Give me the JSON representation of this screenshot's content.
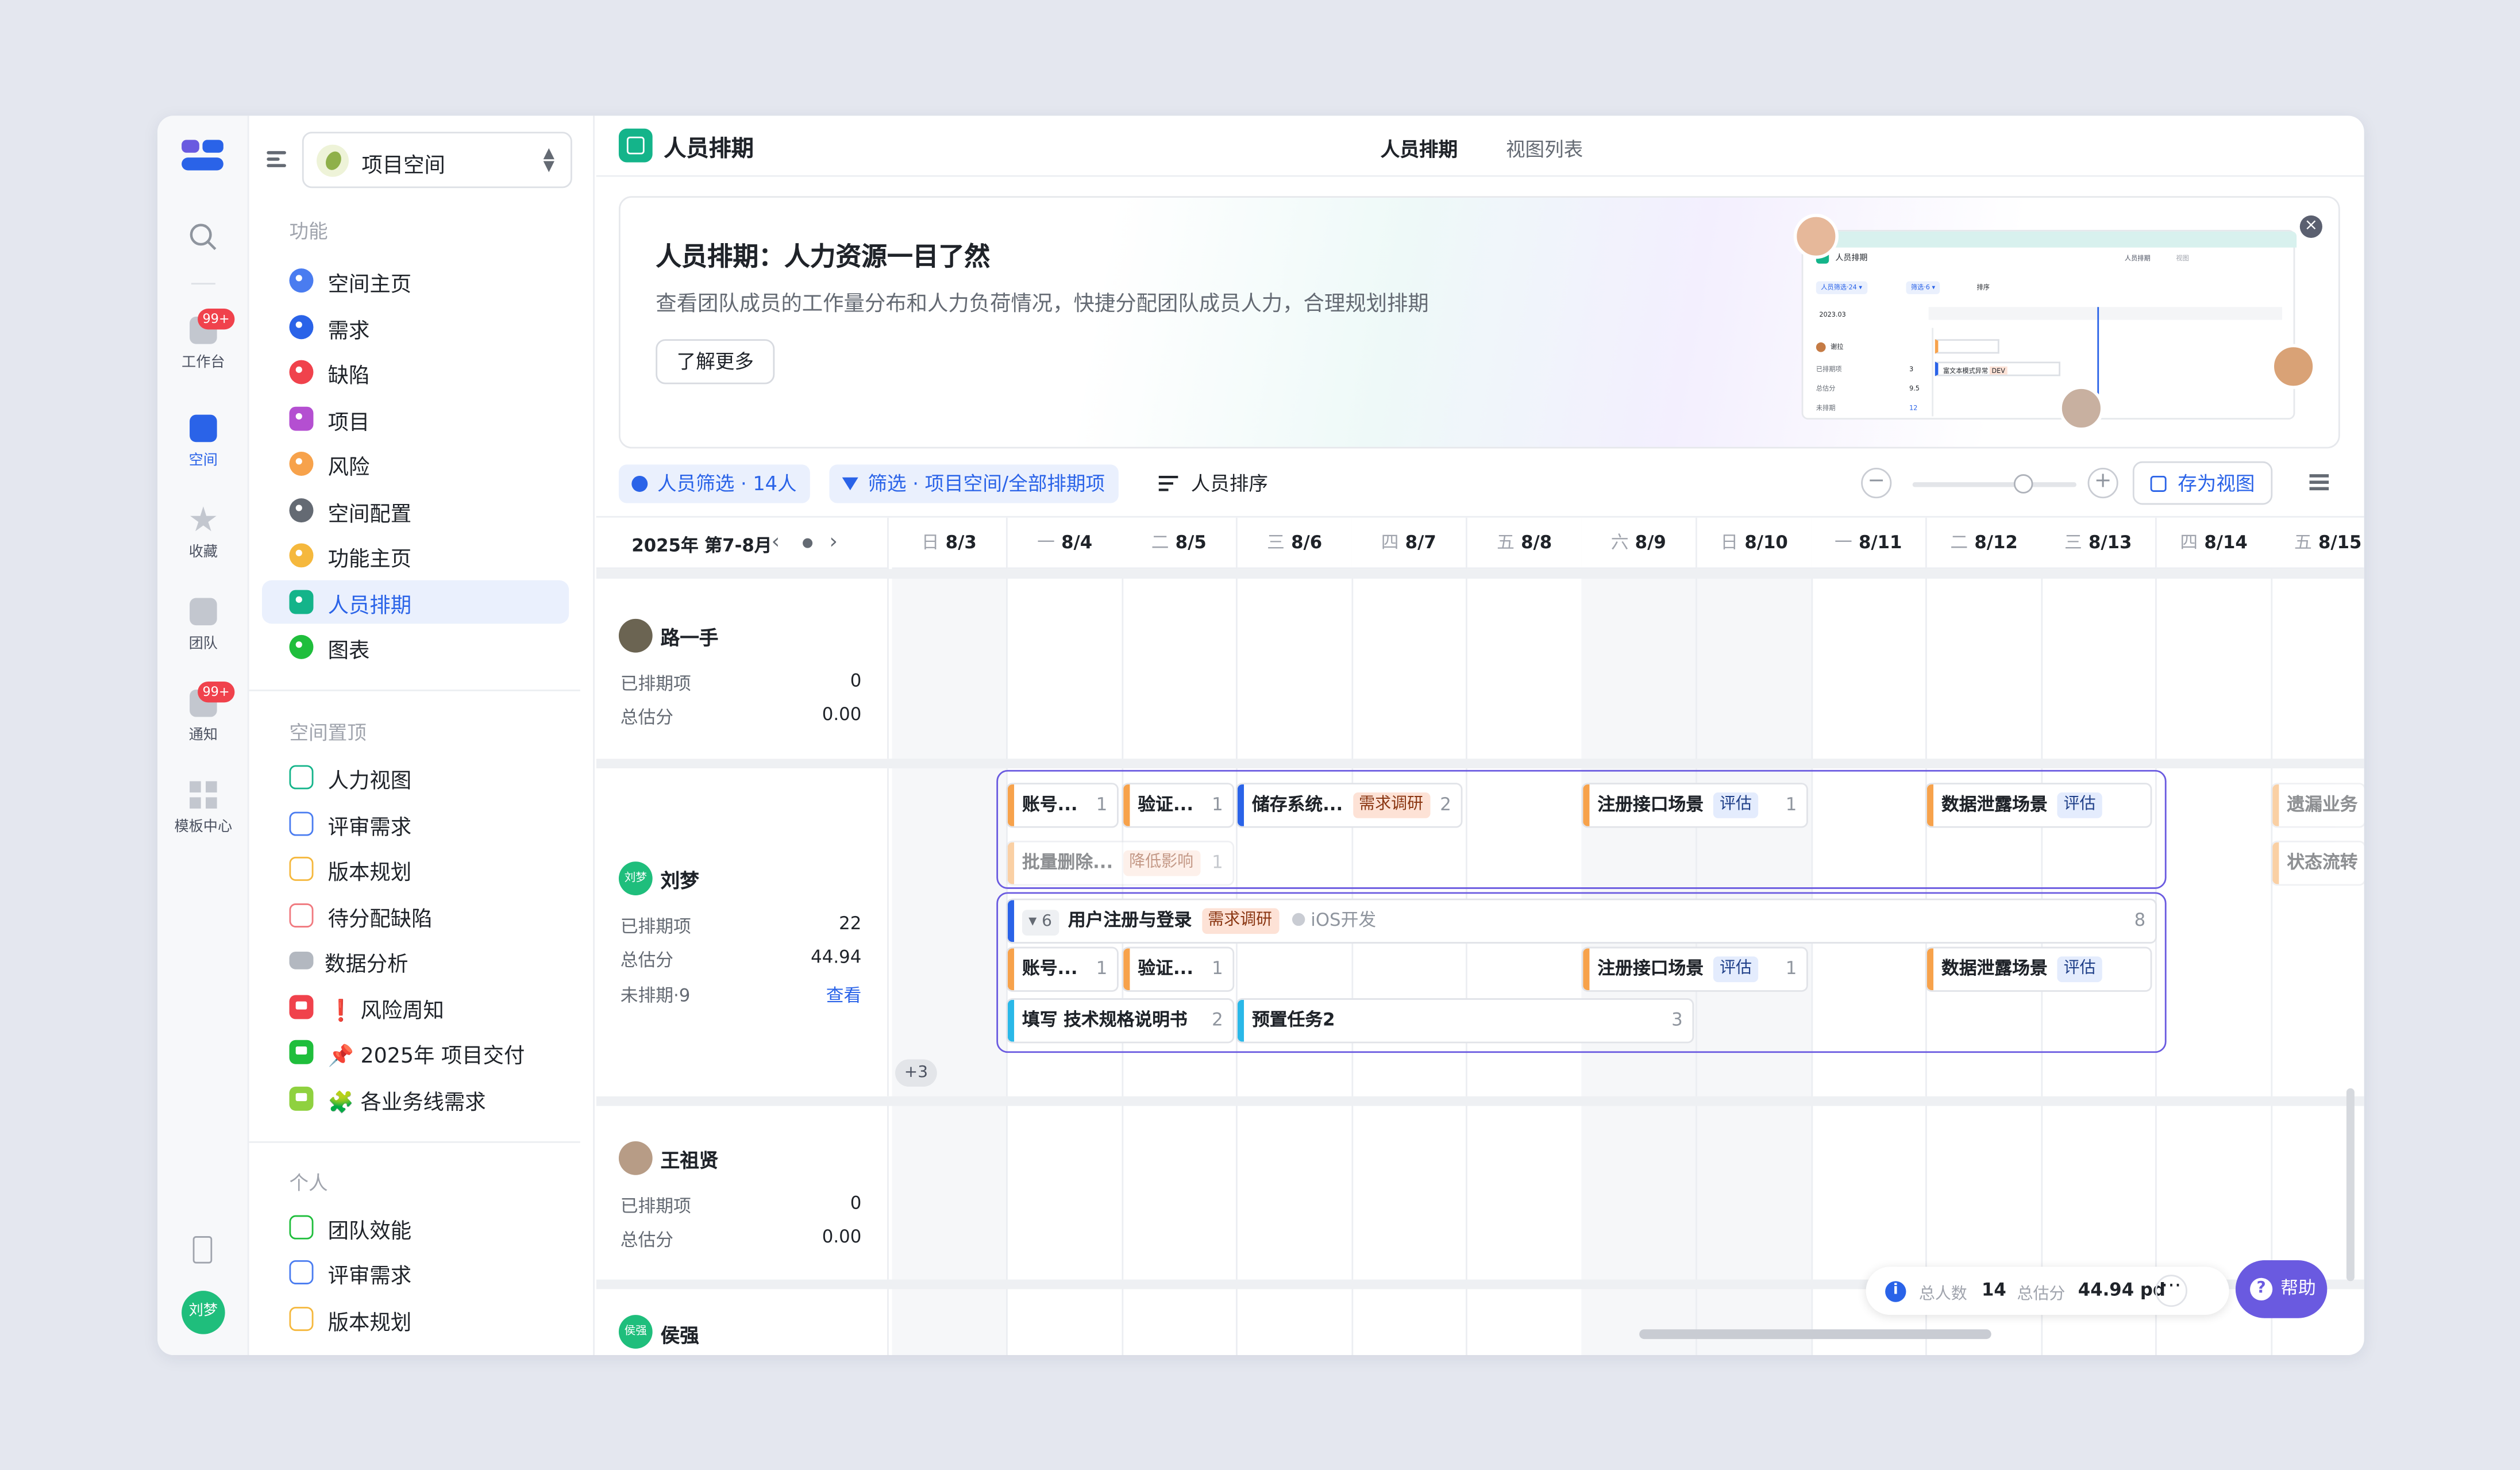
{
  "rail": {
    "items": [
      {
        "label": "工作台",
        "badge": "99+"
      },
      {
        "label": "空间"
      },
      {
        "label": "收藏"
      },
      {
        "label": "团队"
      },
      {
        "label": "通知",
        "badge": "99+"
      },
      {
        "label": "模板中心"
      }
    ],
    "avatar": "刘梦"
  },
  "sidebar": {
    "space": "项目空间",
    "sections": [
      {
        "title": "功能",
        "items": [
          "空间主页",
          "需求",
          "缺陷",
          "项目",
          "风险",
          "空间配置",
          "功能主页",
          "人员排期",
          "图表"
        ]
      },
      {
        "title": "空间置顶",
        "items": [
          "人力视图",
          "评审需求",
          "版本规划",
          "待分配缺陷",
          "数据分析",
          "❗ 风险周知",
          "📌 2025年 项目交付",
          "🧩 各业务线需求"
        ]
      },
      {
        "title": "个人",
        "items": [
          "团队效能",
          "评审需求",
          "版本规划"
        ]
      }
    ],
    "active": "人员排期"
  },
  "header": {
    "title": "人员排期",
    "tabs": [
      "人员排期",
      "视图列表"
    ]
  },
  "banner": {
    "title": "人员排期：人力资源一目了然",
    "desc": "查看团队成员的工作量分布和人力负荷情况，快捷分配团队成员人力，合理规划排期",
    "button": "了解更多",
    "preview": {
      "title": "人员排期",
      "tabs": [
        "人员排期",
        "视图"
      ],
      "filter1": "人员筛选·24 ▾",
      "filter2": "筛选·6 ▾",
      "sort": "排序",
      "month": "2023.03",
      "name": "谢拉",
      "task": "富文本模式异常",
      "tag": "DEV",
      "rows": [
        "已排期项",
        "总估分",
        "未排期"
      ],
      "vals": [
        "3",
        "9.5",
        "12"
      ]
    }
  },
  "toolbar": {
    "people_filter": "人员筛选 · 14人",
    "filter": "筛选 · 项目空间/全部排期项",
    "sort": "人员排序",
    "save_view": "存为视图"
  },
  "grid": {
    "period": "2025年 第7-8月",
    "days": [
      {
        "wd": "日",
        "d": "8/3"
      },
      {
        "wd": "一",
        "d": "8/4"
      },
      {
        "wd": "二",
        "d": "8/5"
      },
      {
        "wd": "三",
        "d": "8/6"
      },
      {
        "wd": "四",
        "d": "8/7"
      },
      {
        "wd": "五",
        "d": "8/8"
      },
      {
        "wd": "六",
        "d": "8/9"
      },
      {
        "wd": "日",
        "d": "8/10"
      },
      {
        "wd": "一",
        "d": "8/11"
      },
      {
        "wd": "二",
        "d": "8/12"
      },
      {
        "wd": "三",
        "d": "8/13"
      },
      {
        "wd": "四",
        "d": "8/14"
      },
      {
        "wd": "五",
        "d": "8/15"
      }
    ]
  },
  "people": [
    {
      "name": "路一手",
      "labels": [
        "已排期项",
        "总估分"
      ],
      "values": [
        "0",
        "0.00"
      ]
    },
    {
      "name": "刘梦",
      "avatar_text": "刘梦",
      "labels": [
        "已排期项",
        "总估分",
        "未排期·9"
      ],
      "values": [
        "22",
        "44.94"
      ],
      "link": "查看"
    },
    {
      "name": "王祖贤",
      "labels": [
        "已排期项",
        "总估分"
      ],
      "values": [
        "0",
        "0.00"
      ]
    },
    {
      "name": "侯强",
      "avatar_text": "侯强"
    }
  ],
  "tasks": [
    {
      "name": "账号...",
      "cnt": "1"
    },
    {
      "name": "验证...",
      "cnt": "1"
    },
    {
      "name": "储存系统...",
      "tag": "需求调研",
      "cnt": "2"
    },
    {
      "name": "注册接口场景",
      "tag": "评估",
      "cnt": "1"
    },
    {
      "name": "数据泄露场景",
      "tag": "评估"
    },
    {
      "name": "遗漏业务"
    },
    {
      "name": "批量删除...",
      "tag": "降低影响",
      "cnt": "1"
    },
    {
      "name": "状态流转"
    },
    {
      "group": "▾ 6",
      "name": "用户注册与登录",
      "tag": "需求调研",
      "extra": "iOS开发",
      "cnt": "8"
    },
    {
      "name": "账号...",
      "cnt": "1"
    },
    {
      "name": "验证...",
      "cnt": "1"
    },
    {
      "name": "注册接口场景",
      "tag": "评估",
      "cnt": "1"
    },
    {
      "name": "数据泄露场景",
      "tag": "评估"
    },
    {
      "name": "填写 技术规格说明书",
      "cnt": "2"
    },
    {
      "name": "预置任务2",
      "cnt": "3"
    }
  ],
  "more": "+3",
  "summary": {
    "people_label": "总人数",
    "people": "14",
    "score_label": "总估分",
    "score": "44.94 pd",
    "more": "···"
  },
  "help": "帮助",
  "colors": {
    "accent": "#2a63e8",
    "purple": "#6a5ae0",
    "orange": "#f7a24b",
    "green": "#14b48a"
  }
}
